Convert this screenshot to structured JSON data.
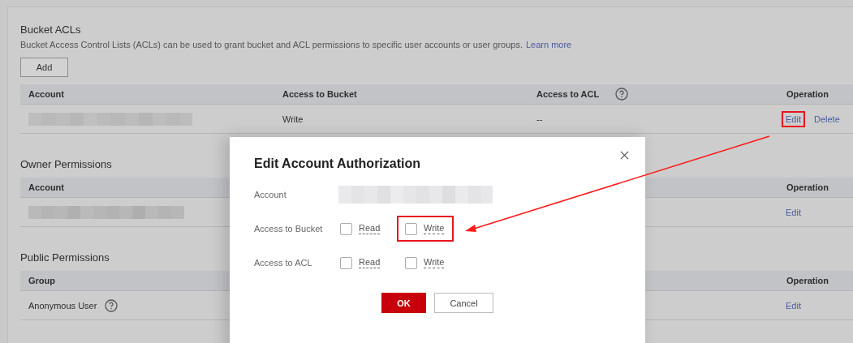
{
  "bucket_acls": {
    "title": "Bucket ACLs",
    "description": "Bucket Access Control Lists (ACLs) can be used to grant bucket and ACL permissions to specific user accounts or user groups.",
    "learn_more": "Learn more",
    "add_button": "Add",
    "columns": [
      {
        "label": "Account",
        "help": false
      },
      {
        "label": "Access to Bucket",
        "help": false
      },
      {
        "label": "Access to ACL",
        "help": true
      },
      {
        "label": "Operation",
        "help": false
      }
    ],
    "rows": [
      {
        "access_to_bucket": "Write",
        "access_to_acl": "--",
        "operations": [
          {
            "label": "Edit",
            "highlighted": true
          },
          {
            "label": "Delete",
            "highlighted": false
          }
        ]
      }
    ]
  },
  "owner_permissions": {
    "title": "Owner Permissions",
    "columns": [
      {
        "label": "Account"
      },
      {
        "label": "Operation"
      }
    ],
    "rows": [
      {
        "name": "",
        "help": false,
        "operations": [
          {
            "label": "Edit",
            "highlighted": false
          }
        ]
      }
    ]
  },
  "public_permissions": {
    "title": "Public Permissions",
    "columns": [
      {
        "label": "Group"
      },
      {
        "label": "Operation"
      }
    ],
    "rows": [
      {
        "name": "Anonymous User",
        "help": true,
        "operations": [
          {
            "label": "Edit",
            "highlighted": false
          }
        ]
      }
    ]
  },
  "dialog": {
    "title": "Edit Account Authorization",
    "account_label": "Account",
    "permissions": [
      {
        "label": "Access to Bucket",
        "options": [
          {
            "label": "Read",
            "checked": false,
            "highlighted": false
          },
          {
            "label": "Write",
            "checked": false,
            "highlighted": true
          }
        ]
      },
      {
        "label": "Access to ACL",
        "options": [
          {
            "label": "Read",
            "checked": false,
            "highlighted": false
          },
          {
            "label": "Write",
            "checked": false,
            "highlighted": false
          }
        ]
      }
    ],
    "ok_button": "OK",
    "cancel_button": "Cancel"
  }
}
